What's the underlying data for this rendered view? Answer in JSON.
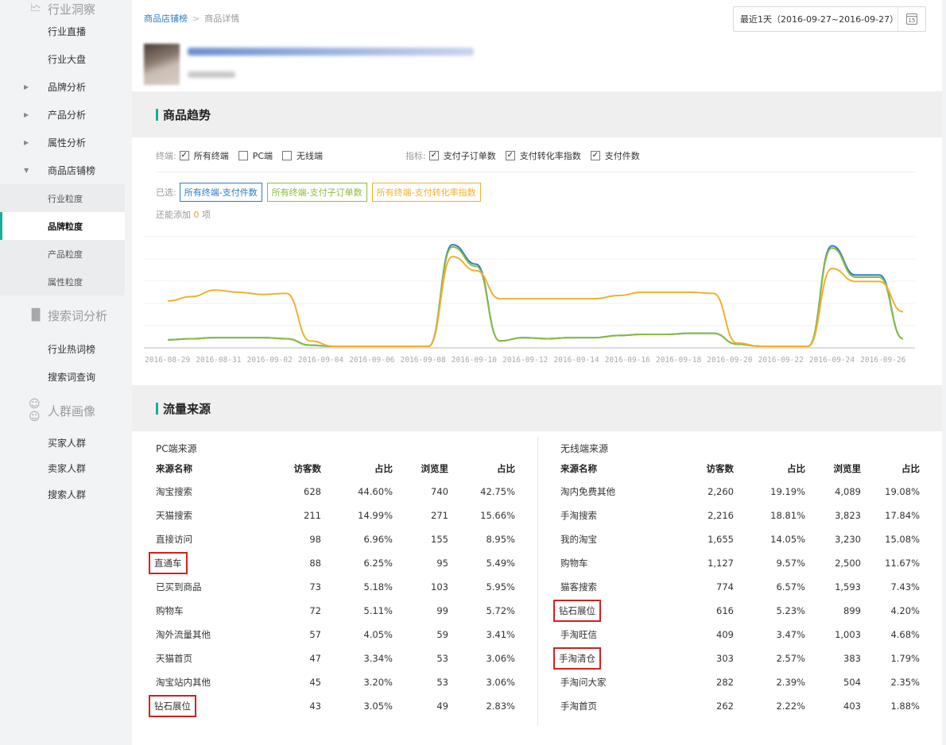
{
  "sidebar": {
    "industry_group": "行业洞察",
    "industry_items": [
      "行业直播",
      "行业大盘"
    ],
    "analysis_items": [
      "品牌分析",
      "产品分析",
      "属性分析"
    ],
    "rank_label": "商品店铺榜",
    "rank_sub": [
      "行业粒度",
      "品牌粒度",
      "产品粒度",
      "属性粒度"
    ],
    "search_group": "搜索词分析",
    "search_items": [
      "行业热词榜",
      "搜索词查询"
    ],
    "crowd_group": "人群画像",
    "crowd_items": [
      "买家人群",
      "卖家人群",
      "搜索人群"
    ]
  },
  "breadcrumb": {
    "link": "商品店铺榜",
    "current": "商品详情"
  },
  "date_range": "最近1天（2016-09-27~2016-09-27）",
  "calendar_day": "15",
  "trend": {
    "title": "商品趋势",
    "terminal_label": "终端:",
    "terminals": [
      {
        "label": "所有终端",
        "checked": true
      },
      {
        "label": "PC端",
        "checked": false
      },
      {
        "label": "无线端",
        "checked": false
      }
    ],
    "metric_label": "指标:",
    "metrics": [
      {
        "label": "支付子订单数",
        "checked": true
      },
      {
        "label": "支付转化率指数",
        "checked": true
      },
      {
        "label": "支付件数",
        "checked": true
      }
    ],
    "selected_label": "已选:",
    "tags": [
      {
        "label": "所有终端-支付件数",
        "color": "#2b7cc9"
      },
      {
        "label": "所有终端-支付子订单数",
        "color": "#8dbb3c"
      },
      {
        "label": "所有终端-支付转化率指数",
        "color": "#f0b030"
      }
    ],
    "more_prefix": "还能添加",
    "more_count": "0",
    "more_suffix": "项"
  },
  "chart_data": {
    "type": "line",
    "x_labels": [
      "2016-08-29",
      "2016-08-31",
      "2016-09-02",
      "2016-09-04",
      "2016-09-06",
      "2016-09-08",
      "2016-09-10",
      "2016-09-12",
      "2016-09-14",
      "2016-09-16",
      "2016-09-18",
      "2016-09-20",
      "2016-09-22",
      "2016-09-24",
      "2016-09-26"
    ],
    "series": [
      {
        "color": "#2b7cc9",
        "values": [
          0.06,
          0.07,
          0.08,
          0.08,
          0.08,
          0.07,
          0.01,
          0.0,
          0.0,
          0.0,
          0.0,
          0.0,
          0.94,
          0.76,
          0.05,
          0.08,
          0.07,
          0.08,
          0.08,
          0.1,
          0.11,
          0.11,
          0.12,
          0.12,
          0.02,
          0.0,
          0.0,
          0.0,
          0.93,
          0.66,
          0.66,
          0.07
        ]
      },
      {
        "color": "#8dbb3c",
        "values": [
          0.06,
          0.07,
          0.08,
          0.08,
          0.08,
          0.07,
          0.01,
          0.0,
          0.0,
          0.0,
          0.0,
          0.0,
          0.92,
          0.74,
          0.05,
          0.08,
          0.07,
          0.08,
          0.08,
          0.1,
          0.11,
          0.11,
          0.12,
          0.12,
          0.02,
          0.0,
          0.0,
          0.0,
          0.91,
          0.64,
          0.64,
          0.07
        ]
      },
      {
        "color": "#f0b030",
        "values": [
          0.42,
          0.46,
          0.52,
          0.5,
          0.48,
          0.49,
          0.05,
          0.0,
          0.0,
          0.0,
          0.0,
          0.0,
          0.83,
          0.7,
          0.44,
          0.44,
          0.44,
          0.44,
          0.44,
          0.47,
          0.5,
          0.5,
          0.5,
          0.49,
          0.03,
          0.0,
          0.0,
          0.0,
          0.72,
          0.6,
          0.6,
          0.32
        ]
      }
    ]
  },
  "traffic": {
    "title": "流量来源",
    "pc": {
      "title": "PC端来源",
      "headers": [
        "来源名称",
        "访客数",
        "占比",
        "浏览里",
        "占比"
      ],
      "rows": [
        [
          "淘宝搜索",
          "628",
          "44.60%",
          "740",
          "42.75%"
        ],
        [
          "天猫搜索",
          "211",
          "14.99%",
          "271",
          "15.66%"
        ],
        [
          "直接访问",
          "98",
          "6.96%",
          "155",
          "8.95%"
        ],
        [
          "直通车",
          "88",
          "6.25%",
          "95",
          "5.49%"
        ],
        [
          "已买到商品",
          "73",
          "5.18%",
          "103",
          "5.95%"
        ],
        [
          "购物车",
          "72",
          "5.11%",
          "99",
          "5.72%"
        ],
        [
          "淘外流量其他",
          "57",
          "4.05%",
          "59",
          "3.41%"
        ],
        [
          "天猫首页",
          "47",
          "3.34%",
          "53",
          "3.06%"
        ],
        [
          "淘宝站内其他",
          "45",
          "3.20%",
          "53",
          "3.06%"
        ],
        [
          "钻石展位",
          "43",
          "3.05%",
          "49",
          "2.83%"
        ]
      ],
      "highlight_rows": [
        3,
        9
      ]
    },
    "mobile": {
      "title": "无线端来源",
      "headers": [
        "来源名称",
        "访客数",
        "占比",
        "浏览里",
        "占比"
      ],
      "rows": [
        [
          "淘内免费其他",
          "2,260",
          "19.19%",
          "4,089",
          "19.08%"
        ],
        [
          "手淘搜索",
          "2,216",
          "18.81%",
          "3,823",
          "17.84%"
        ],
        [
          "我的淘宝",
          "1,655",
          "14.05%",
          "3,230",
          "15.08%"
        ],
        [
          "购物车",
          "1,127",
          "9.57%",
          "2,500",
          "11.67%"
        ],
        [
          "猫客搜索",
          "774",
          "6.57%",
          "1,593",
          "7.43%"
        ],
        [
          "钻石展位",
          "616",
          "5.23%",
          "899",
          "4.20%"
        ],
        [
          "手淘旺信",
          "409",
          "3.47%",
          "1,003",
          "4.68%"
        ],
        [
          "手淘清仓",
          "303",
          "2.57%",
          "383",
          "1.79%"
        ],
        [
          "手淘问大家",
          "282",
          "2.39%",
          "504",
          "2.35%"
        ],
        [
          "手淘首页",
          "262",
          "2.22%",
          "403",
          "1.88%"
        ]
      ],
      "highlight_rows": [
        5,
        7
      ]
    }
  }
}
